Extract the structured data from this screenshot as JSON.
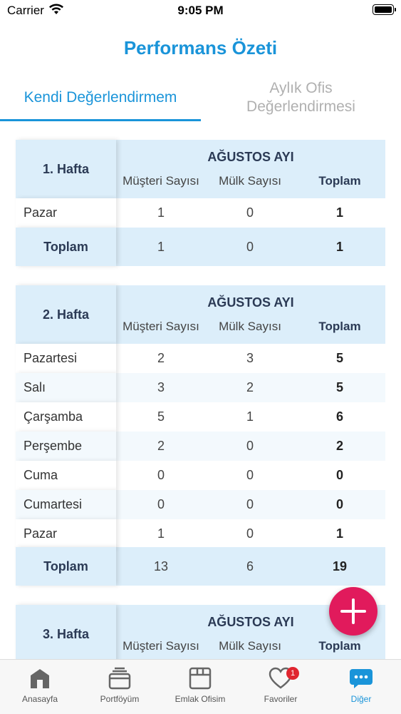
{
  "status_bar": {
    "carrier": "Carrier",
    "time": "9:05 PM"
  },
  "header": {
    "title": "Performans Özeti"
  },
  "tabs": [
    {
      "label": "Kendi Değerlendirmem",
      "active": true
    },
    {
      "label": "Aylık Ofis Değerlendirmesi",
      "active": false
    }
  ],
  "columns": {
    "month": "AĞUSTOS AYI",
    "customers": "Müşteri Sayısı",
    "properties": "Mülk Sayısı",
    "total": "Toplam"
  },
  "weeks": [
    {
      "label": "1. Hafta",
      "rows": [
        {
          "day": "Pazar",
          "customers": "1",
          "properties": "0",
          "total": "1"
        }
      ],
      "summary": {
        "label": "Toplam",
        "customers": "1",
        "properties": "0",
        "total": "1"
      }
    },
    {
      "label": "2. Hafta",
      "rows": [
        {
          "day": "Pazartesi",
          "customers": "2",
          "properties": "3",
          "total": "5"
        },
        {
          "day": "Salı",
          "customers": "3",
          "properties": "2",
          "total": "5"
        },
        {
          "day": "Çarşamba",
          "customers": "5",
          "properties": "1",
          "total": "6"
        },
        {
          "day": "Perşembe",
          "customers": "2",
          "properties": "0",
          "total": "2"
        },
        {
          "day": "Cuma",
          "customers": "0",
          "properties": "0",
          "total": "0"
        },
        {
          "day": "Cumartesi",
          "customers": "0",
          "properties": "0",
          "total": "0"
        },
        {
          "day": "Pazar",
          "customers": "1",
          "properties": "0",
          "total": "1"
        }
      ],
      "summary": {
        "label": "Toplam",
        "customers": "13",
        "properties": "6",
        "total": "19"
      }
    },
    {
      "label": "3. Hafta"
    }
  ],
  "fab": {
    "icon": "plus-icon"
  },
  "tabbar": [
    {
      "label": "Anasayfa",
      "icon": "home-icon"
    },
    {
      "label": "Portföyüm",
      "icon": "portfolio-icon"
    },
    {
      "label": "Emlak Ofisim",
      "icon": "office-box-icon"
    },
    {
      "label": "Favoriler",
      "icon": "heart-icon",
      "badge": "1"
    },
    {
      "label": "Diğer",
      "icon": "more-icon",
      "active": true
    }
  ],
  "colors": {
    "accent": "#1a94d9",
    "fab": "#e11a5c",
    "header_bg": "#dceefa"
  }
}
